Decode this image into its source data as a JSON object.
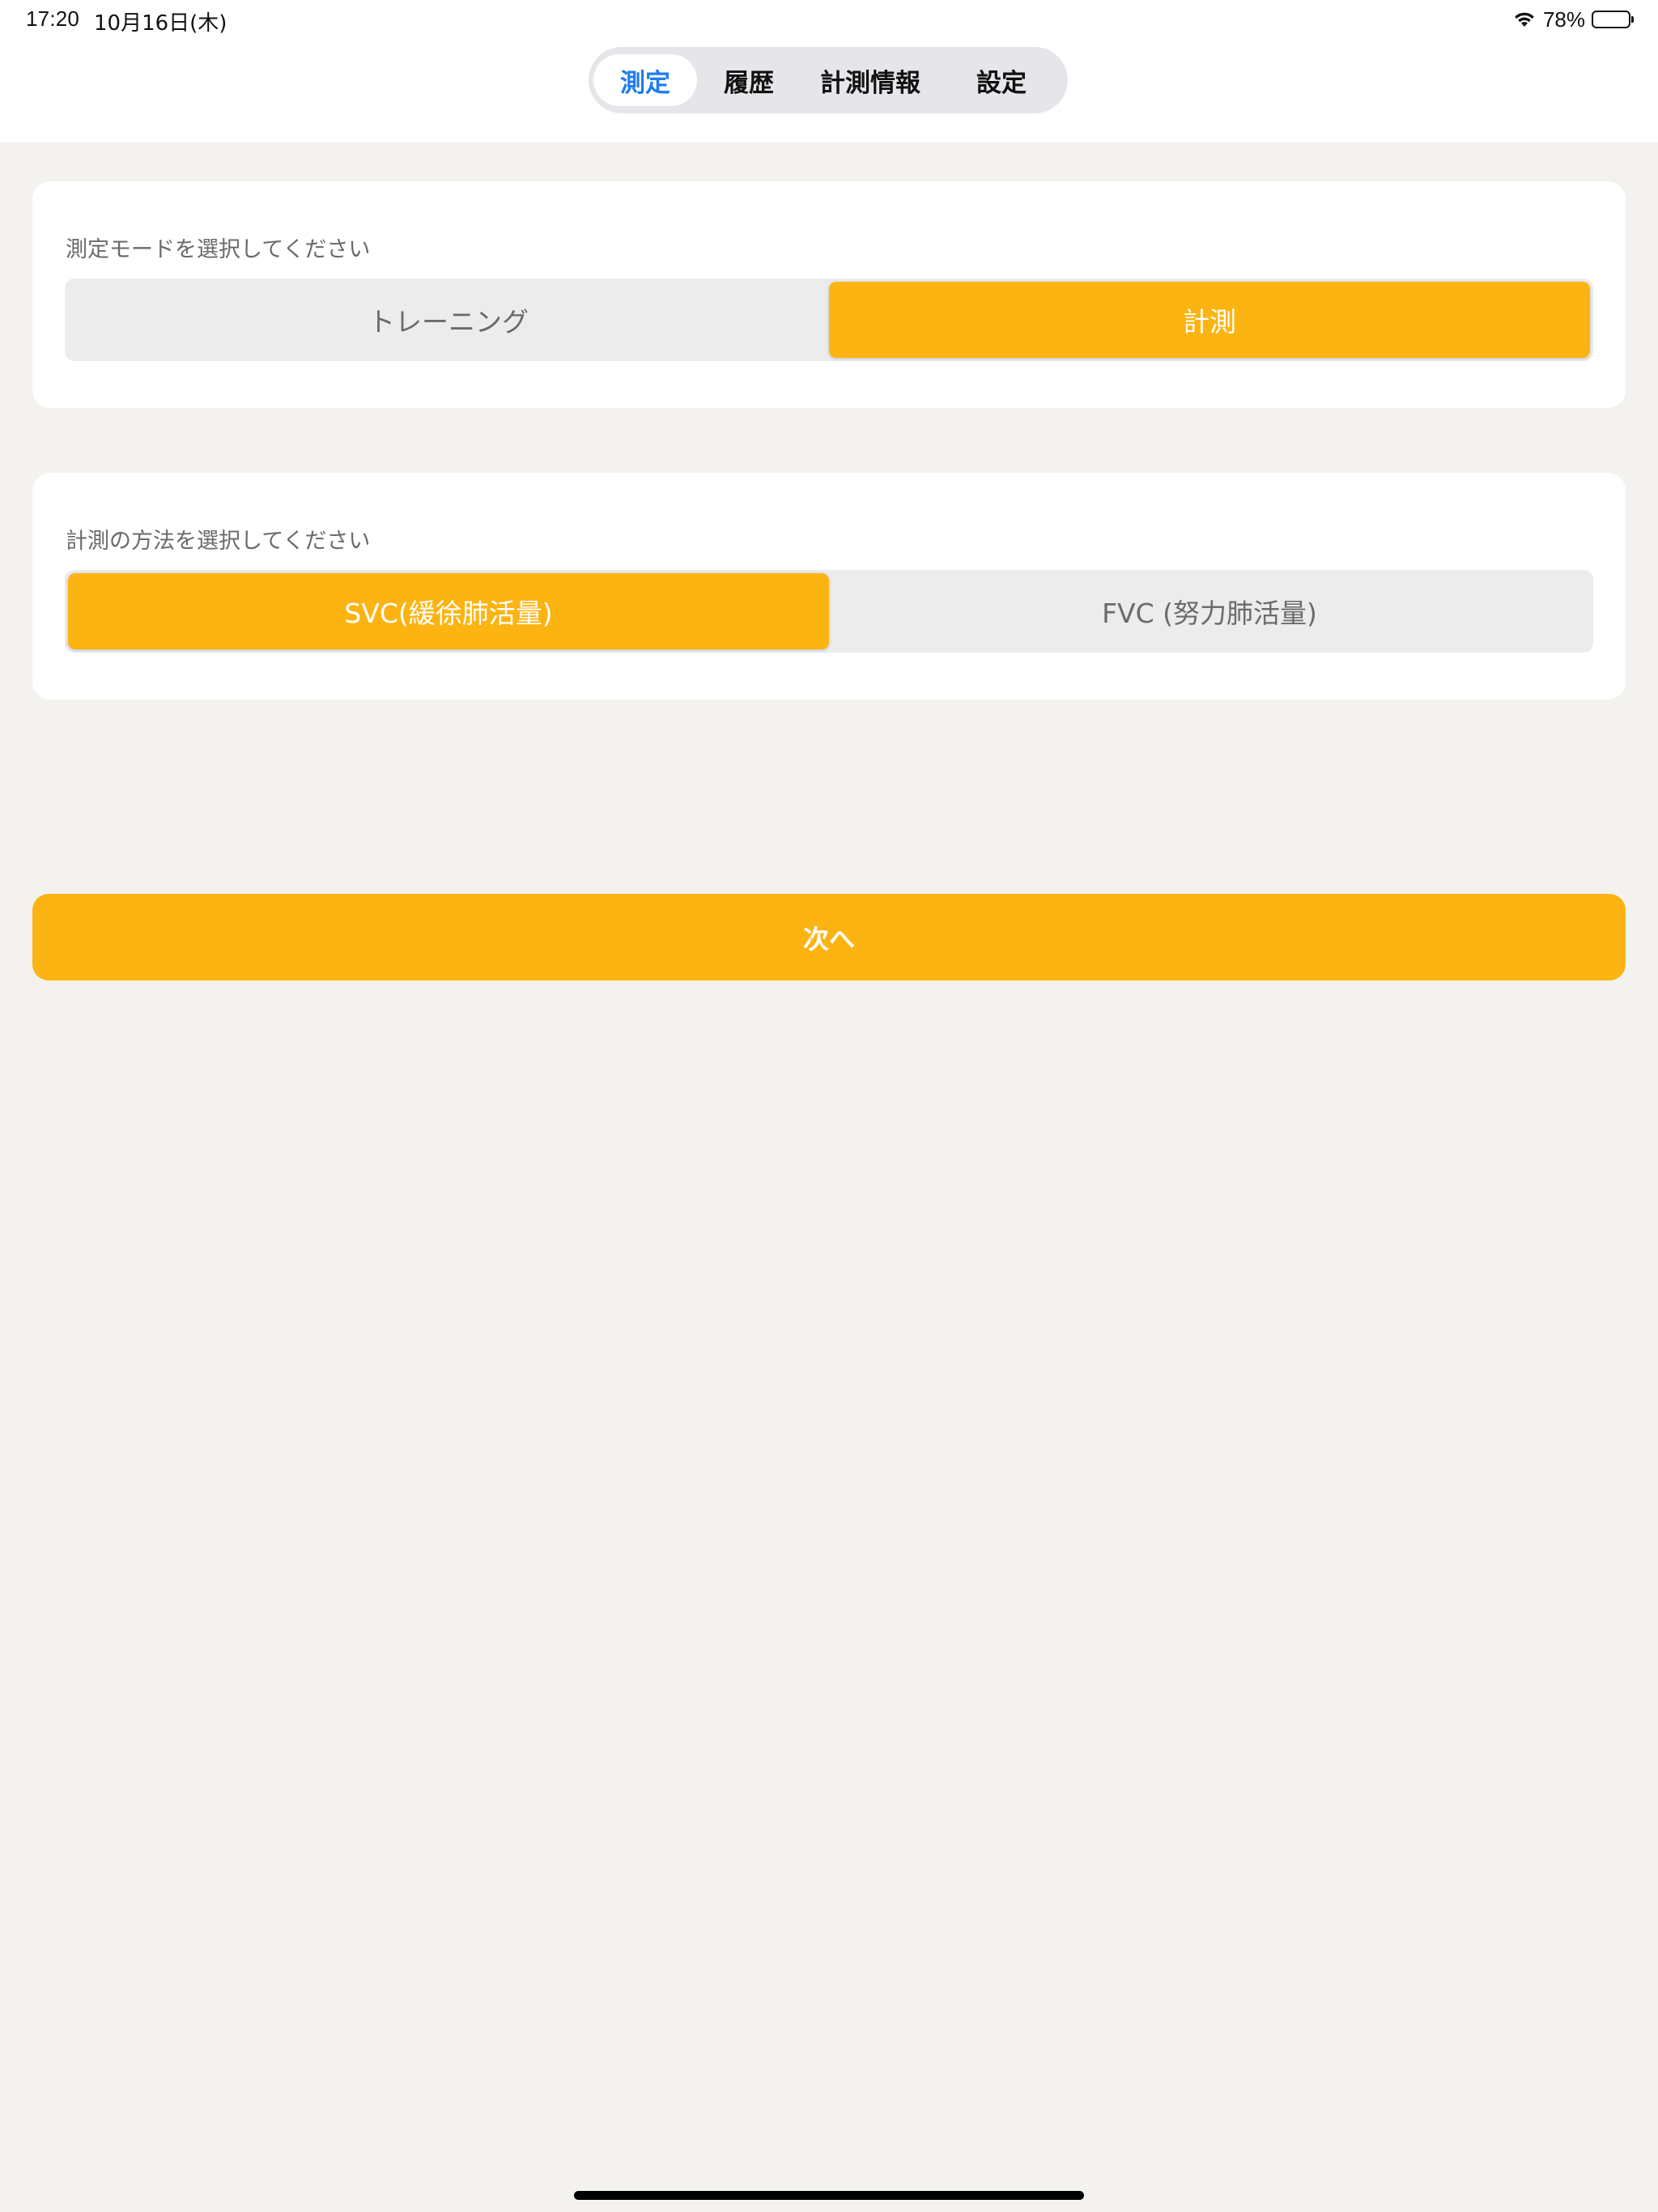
{
  "status_bar": {
    "time": "17:20",
    "date": "10月16日(木)",
    "battery_percent": "78%",
    "battery_level": 0.78
  },
  "tabs": [
    {
      "label": "測定",
      "active": true
    },
    {
      "label": "履歴",
      "active": false
    },
    {
      "label": "計測情報",
      "active": false
    },
    {
      "label": "設定",
      "active": false
    }
  ],
  "mode_section": {
    "label": "測定モードを選択してください",
    "options": [
      {
        "label": "トレーニング",
        "selected": false
      },
      {
        "label": "計測",
        "selected": true
      }
    ]
  },
  "method_section": {
    "label": "計測の方法を選択してください",
    "options": [
      {
        "label": "SVC(緩徐肺活量)",
        "selected": true
      },
      {
        "label": "FVC (努力肺活量)",
        "selected": false
      }
    ]
  },
  "next_button": {
    "label": "次へ"
  },
  "colors": {
    "accent": "#fcb412",
    "tab_active_text": "#1f7cf2",
    "background": "#f3f2ef"
  }
}
